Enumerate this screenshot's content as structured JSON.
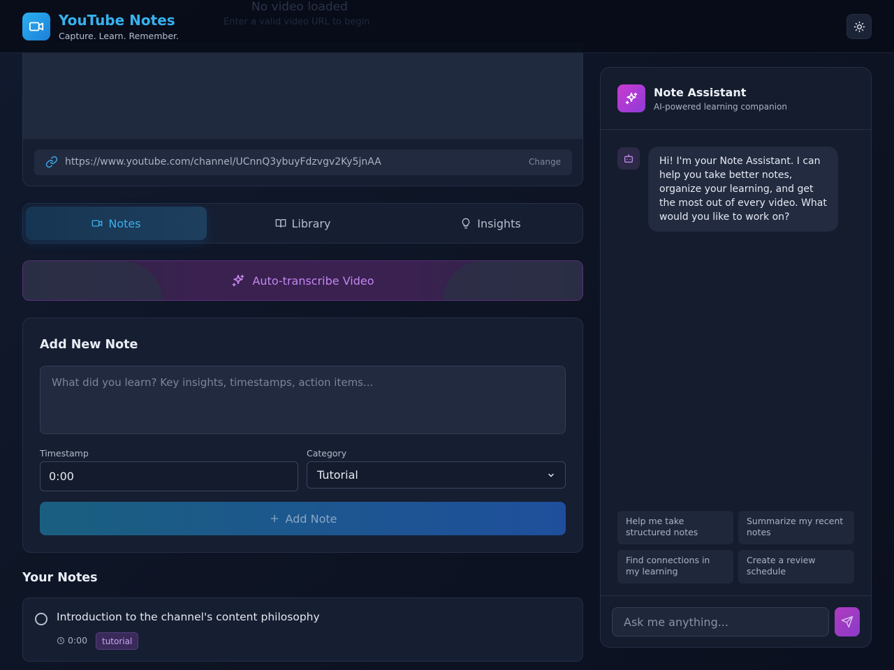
{
  "header": {
    "title": "YouTube Notes",
    "subtitle": "Capture. Learn. Remember.",
    "overlay_title": "No video loaded",
    "overlay_sub": "Enter a valid video URL to begin"
  },
  "video": {
    "url": "https://www.youtube.com/channel/UCnnQ3ybuyFdzvgv2Ky5jnAA",
    "change_label": "Change"
  },
  "tabs": [
    {
      "label": "Notes",
      "icon": "video-icon",
      "active": true
    },
    {
      "label": "Library",
      "icon": "book-icon",
      "active": false
    },
    {
      "label": "Insights",
      "icon": "lightbulb-icon",
      "active": false
    }
  ],
  "transcribe": {
    "label": "Auto-transcribe Video",
    "icon": "sparkles-icon"
  },
  "add_note": {
    "title": "Add New Note",
    "textarea_placeholder": "What did you learn? Key insights, timestamps, action items...",
    "timestamp_label": "Timestamp",
    "timestamp_value": "0:00",
    "category_label": "Category",
    "category_value": "Tutorial",
    "button_label": "Add Note"
  },
  "notes": {
    "title": "Your Notes",
    "items": [
      {
        "text": "Introduction to the channel's content philosophy",
        "timestamp": "0:00",
        "tag": "tutorial"
      }
    ]
  },
  "assistant": {
    "title": "Note Assistant",
    "subtitle": "AI-powered learning companion",
    "greeting": "Hi! I'm your Note Assistant. I can help you take better notes, organize your learning, and get the most out of every video. What would you like to work on?",
    "suggestions": [
      "Help me take structured notes",
      "Summarize my recent notes",
      "Find connections in my learning",
      "Create a review schedule"
    ],
    "input_placeholder": "Ask me anything..."
  },
  "colors": {
    "accent": "#38b2f0",
    "purple": "#c487f0",
    "background": "#0f1526"
  }
}
